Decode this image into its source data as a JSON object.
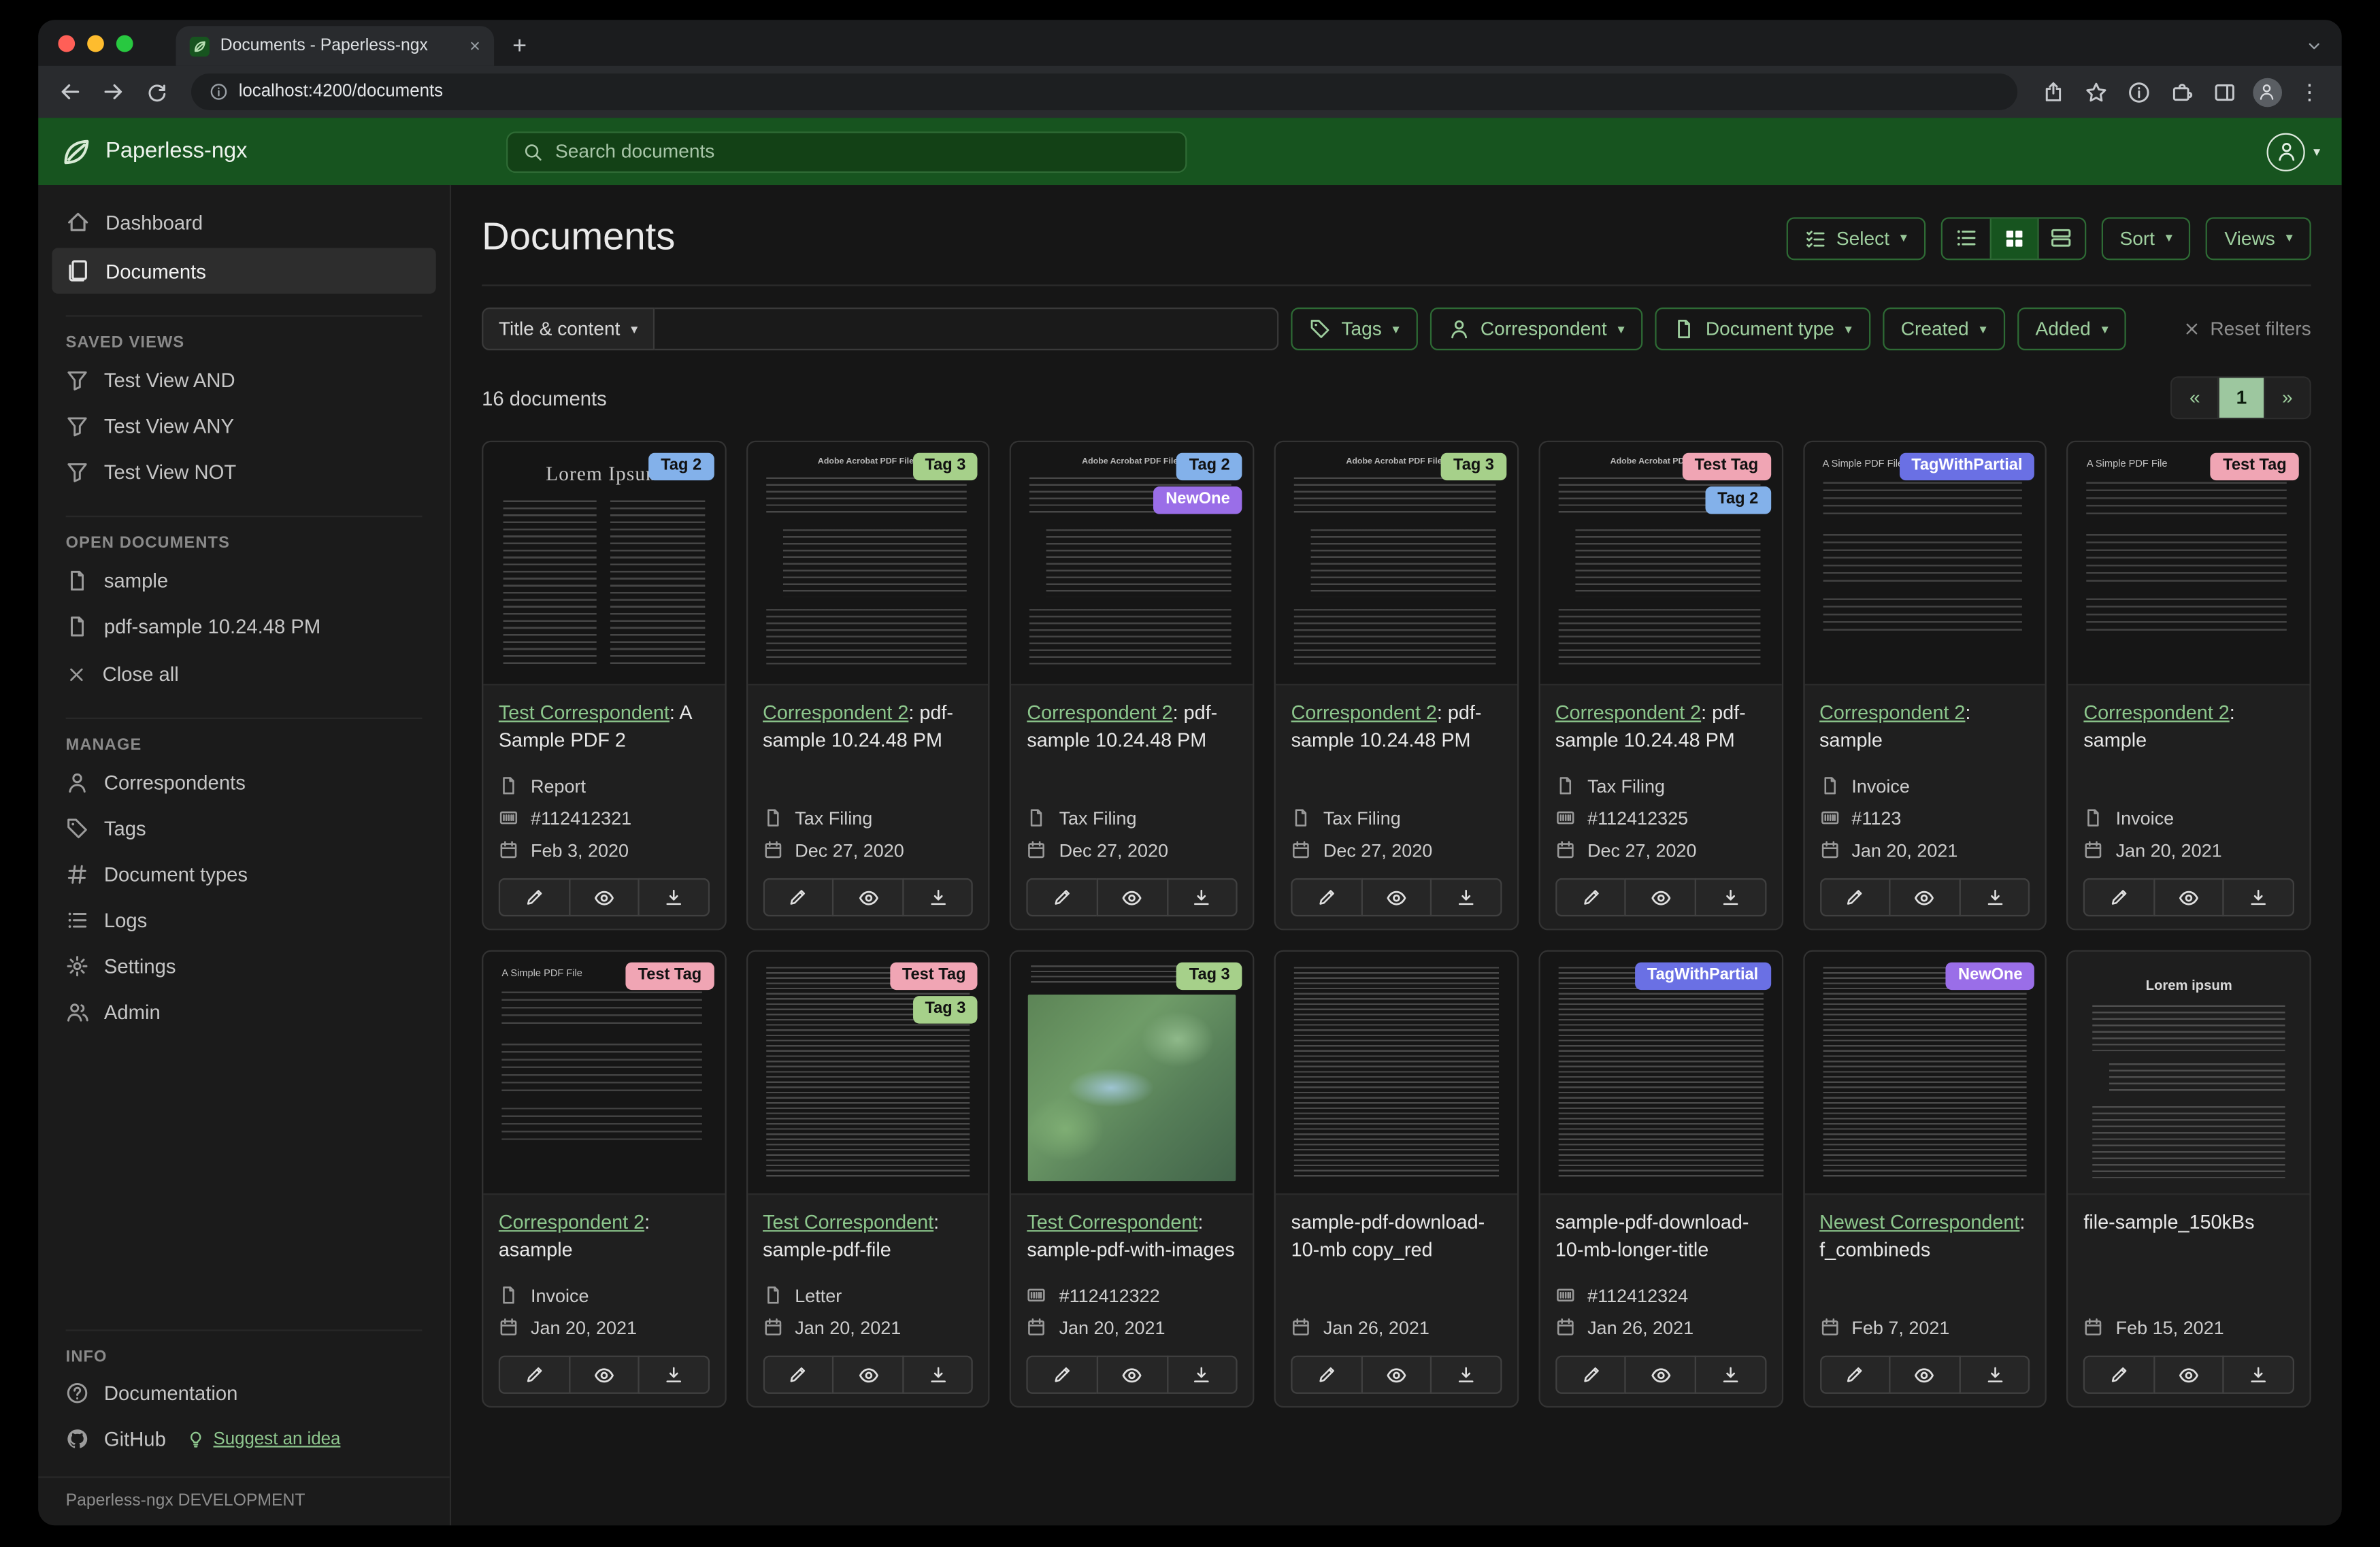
{
  "browser": {
    "tab_title": "Documents - Paperless-ngx",
    "url": "localhost:4200/documents"
  },
  "app_header": {
    "brand": "Paperless-ngx",
    "search_placeholder": "Search documents"
  },
  "sidebar": {
    "dashboard": "Dashboard",
    "documents": "Documents",
    "saved_views_title": "SAVED VIEWS",
    "saved_views": [
      {
        "label": "Test View AND"
      },
      {
        "label": "Test View ANY"
      },
      {
        "label": "Test View NOT"
      }
    ],
    "open_documents_title": "OPEN DOCUMENTS",
    "open_documents": [
      {
        "label": "sample"
      },
      {
        "label": "pdf-sample 10.24.48 PM"
      }
    ],
    "close_all": "Close all",
    "manage_title": "MANAGE",
    "manage": [
      {
        "label": "Correspondents",
        "icon": "#i-person"
      },
      {
        "label": "Tags",
        "icon": "#i-tag"
      },
      {
        "label": "Document types",
        "icon": "#i-hash"
      },
      {
        "label": "Logs",
        "icon": "#i-list"
      },
      {
        "label": "Settings",
        "icon": "#i-gear"
      },
      {
        "label": "Admin",
        "icon": "#i-people"
      }
    ],
    "info_title": "INFO",
    "documentation": "Documentation",
    "github": "GitHub",
    "suggest": "Suggest an idea",
    "footer": "Paperless-ngx DEVELOPMENT"
  },
  "main": {
    "title": "Documents",
    "select_label": "Select",
    "sort_label": "Sort",
    "views_label": "Views",
    "filter": {
      "field_label": "Title & content",
      "tags": "Tags",
      "correspondent": "Correspondent",
      "doc_type": "Document type",
      "created": "Created",
      "added": "Added",
      "reset": "Reset filters"
    },
    "count": "16 documents",
    "pagination": {
      "prev": "«",
      "page": "1",
      "next": "»"
    }
  },
  "documents": {
    "cards": [
      {
        "thumb": "t-lorem",
        "thumb_title": "Lorem Ipsum",
        "tags": [
          {
            "label": "Tag 2",
            "bg": "#83b1ea",
            "fg": "#111111"
          }
        ],
        "correspondent": "Test Correspondent",
        "title_rest": ": A Sample PDF 2",
        "doc_type": "Report",
        "asn": "#112412321",
        "date": "Feb 3, 2020"
      },
      {
        "thumb": "t-adobe",
        "thumb_title": "Adobe Acrobat PDF Files",
        "tags": [
          {
            "label": "Tag 3",
            "bg": "#a6d08a",
            "fg": "#111111"
          }
        ],
        "correspondent": "Correspondent 2",
        "title_rest": ": pdf-sample 10.24.48 PM",
        "doc_type": "Tax Filing",
        "date": "Dec 27, 2020"
      },
      {
        "thumb": "t-adobe",
        "thumb_title": "Adobe Acrobat PDF Files",
        "tags": [
          {
            "label": "Tag 2",
            "bg": "#83b1ea",
            "fg": "#111111"
          },
          {
            "label": "NewOne",
            "bg": "#9a6ee8",
            "fg": "#ffffff"
          }
        ],
        "correspondent": "Correspondent 2",
        "title_rest": ": pdf-sample 10.24.48 PM",
        "doc_type": "Tax Filing",
        "date": "Dec 27, 2020"
      },
      {
        "thumb": "t-adobe",
        "thumb_title": "Adobe Acrobat PDF Files",
        "tags": [
          {
            "label": "Tag 3",
            "bg": "#a6d08a",
            "fg": "#111111"
          }
        ],
        "correspondent": "Correspondent 2",
        "title_rest": ": pdf-sample 10.24.48 PM",
        "doc_type": "Tax Filing",
        "date": "Dec 27, 2020"
      },
      {
        "thumb": "t-adobe",
        "thumb_title": "Adobe Acrobat PDF Files",
        "tags": [
          {
            "label": "Test Tag",
            "bg": "#f0a5b4",
            "fg": "#111111"
          },
          {
            "label": "Tag 2",
            "bg": "#83b1ea",
            "fg": "#111111"
          }
        ],
        "correspondent": "Correspondent 2",
        "title_rest": ": pdf-sample 10.24.48 PM",
        "doc_type": "Tax Filing",
        "asn": "#112412325",
        "date": "Dec 27, 2020"
      },
      {
        "thumb": "t-simple",
        "thumb_title": "A Simple PDF File",
        "tags": [
          {
            "label": "TagWithPartial",
            "bg": "#6a70e4",
            "fg": "#ffffff"
          }
        ],
        "correspondent": "Correspondent 2",
        "title_rest": ": sample",
        "doc_type": "Invoice",
        "asn": "#1123",
        "date": "Jan 20, 2021"
      },
      {
        "thumb": "t-simple",
        "thumb_title": "A Simple PDF File",
        "tags": [
          {
            "label": "Test Tag",
            "bg": "#f0a5b4",
            "fg": "#111111"
          }
        ],
        "correspondent": "Correspondent 2",
        "title_rest": ": sample",
        "doc_type": "Invoice",
        "date": "Jan 20, 2021"
      },
      {
        "thumb": "t-simple",
        "thumb_title": "A Simple PDF File",
        "tags": [
          {
            "label": "Test Tag",
            "bg": "#f0a5b4",
            "fg": "#111111"
          }
        ],
        "correspondent": "Correspondent 2",
        "title_rest": ": asample",
        "doc_type": "Invoice",
        "date": "Jan 20, 2021"
      },
      {
        "thumb": "t-dense",
        "tags": [
          {
            "label": "Test Tag",
            "bg": "#f0a5b4",
            "fg": "#111111"
          },
          {
            "label": "Tag 3",
            "bg": "#a6d08a",
            "fg": "#111111"
          }
        ],
        "correspondent": "Test Correspondent",
        "title_rest": ": sample-pdf-file",
        "doc_type": "Letter",
        "date": "Jan 20, 2021"
      },
      {
        "thumb": "t-map",
        "tags": [
          {
            "label": "Tag 3",
            "bg": "#a6d08a",
            "fg": "#111111"
          }
        ],
        "correspondent": "Test Correspondent",
        "title_rest": ": sample-pdf-with-images",
        "asn": "#112412322",
        "date": "Jan 20, 2021"
      },
      {
        "thumb": "t-dense",
        "tags": [],
        "title_rest": "sample-pdf-download-10-mb copy_red",
        "date": "Jan 26, 2021"
      },
      {
        "thumb": "t-dense",
        "tags": [
          {
            "label": "TagWithPartial",
            "bg": "#6a70e4",
            "fg": "#ffffff"
          }
        ],
        "title_rest": "sample-pdf-download-10-mb-longer-title",
        "asn": "#112412324",
        "date": "Jan 26, 2021"
      },
      {
        "thumb": "t-dense",
        "tags": [
          {
            "label": "NewOne",
            "bg": "#9a6ee8",
            "fg": "#ffffff"
          }
        ],
        "correspondent": "Newest Correspondent",
        "title_rest": ": f_combineds",
        "date": "Feb 7, 2021"
      },
      {
        "thumb": "t-loremlight",
        "thumb_title": "Lorem ipsum",
        "tags": [],
        "title_rest": "file-sample_150kBs",
        "date": "Feb 15, 2021"
      }
    ]
  }
}
